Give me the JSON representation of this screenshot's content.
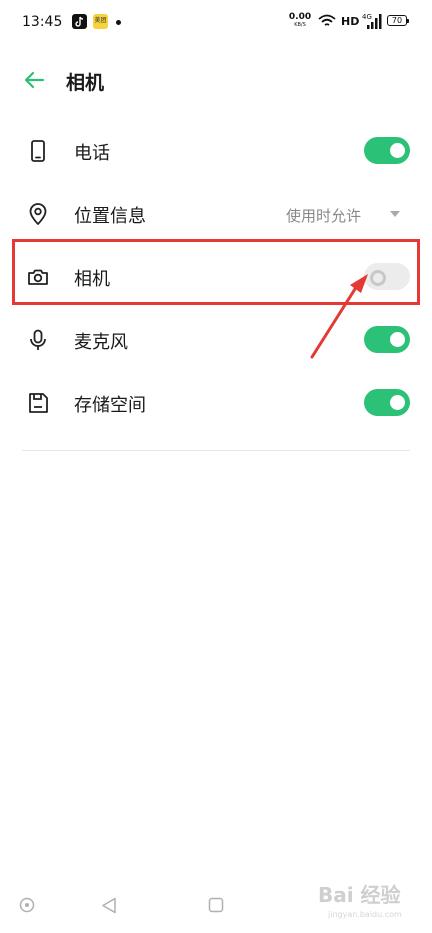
{
  "status_bar": {
    "time": "13:45",
    "app_badge": "美团",
    "net_speed_value": "0.00",
    "net_speed_unit": "KB/S",
    "hd": "HD",
    "signal": "4G",
    "battery": "70"
  },
  "header": {
    "title": "相机"
  },
  "permissions": [
    {
      "label": "电话",
      "icon": "phone-icon",
      "state": "on"
    },
    {
      "label": "位置信息",
      "icon": "location-icon",
      "value": "使用时允许"
    },
    {
      "label": "相机",
      "icon": "camera-icon",
      "state": "off"
    },
    {
      "label": "麦克风",
      "icon": "microphone-icon",
      "state": "on"
    },
    {
      "label": "存储空间",
      "icon": "storage-icon",
      "state": "on"
    }
  ],
  "watermark": {
    "text": "Bai 经验",
    "sub": "jingyan.baidu.com"
  },
  "colors": {
    "accent": "#2bc177",
    "highlight": "#e53935",
    "toggle_off": "#ececec"
  }
}
